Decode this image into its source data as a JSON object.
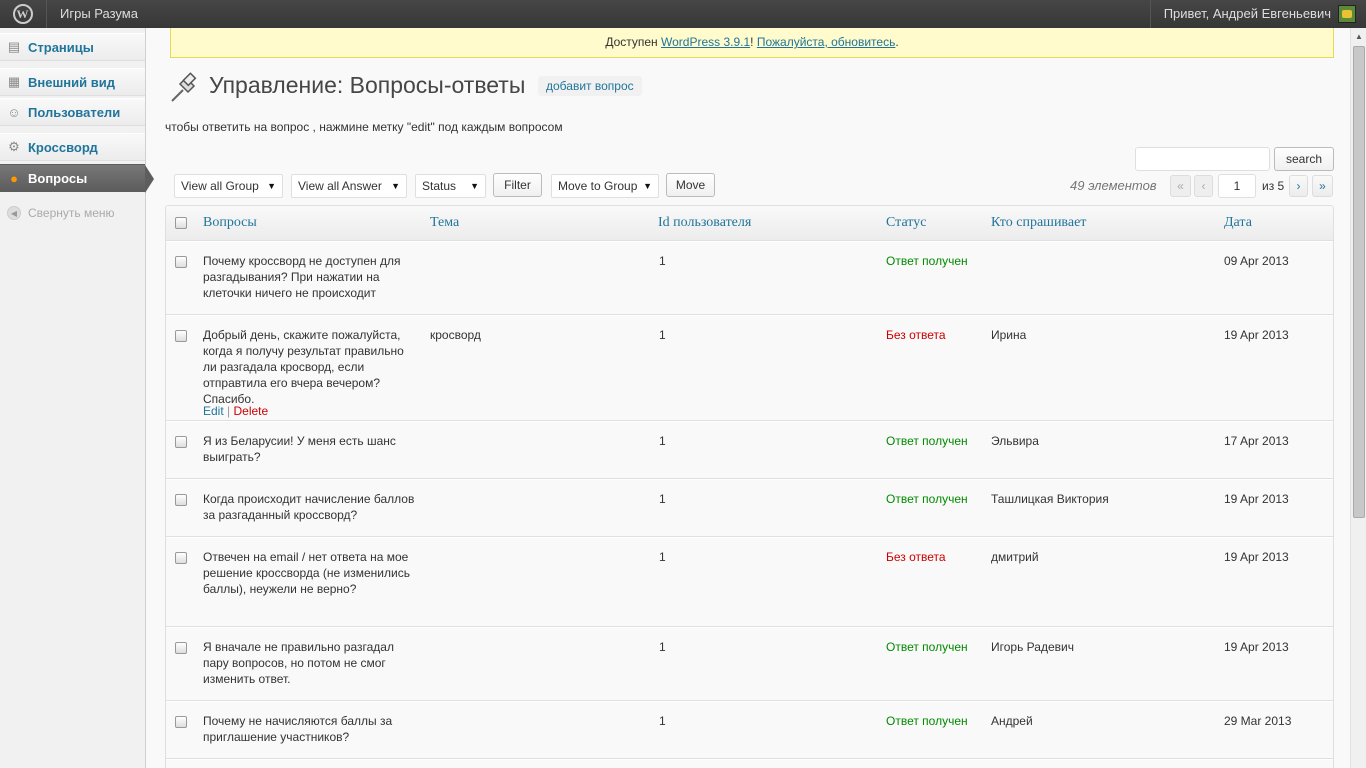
{
  "adminbar": {
    "logo_glyph": "W",
    "site_name": "Игры Разума",
    "howdy": "Привет, Андрей Евгеньевич"
  },
  "sidebar": {
    "items": [
      {
        "label": "Страницы",
        "icon": "pages-icon",
        "glyph": "▤"
      },
      {
        "label": "Внешний вид",
        "icon": "appearance-icon",
        "glyph": "▦"
      },
      {
        "label": "Пользователи",
        "icon": "users-icon",
        "glyph": "☺"
      },
      {
        "label": "Кроссворд",
        "icon": "gear-icon",
        "glyph": "⚙"
      },
      {
        "label": "Вопросы",
        "icon": "questions-icon",
        "glyph": "●"
      }
    ],
    "collapse_label": "Свернуть меню",
    "collapse_glyph": "◀"
  },
  "update_nag": {
    "prefix": "Доступен ",
    "link1": "WordPress 3.9.1",
    "sep": "! ",
    "link2": "Пожалуйста, обновитесь",
    "suffix": "."
  },
  "page": {
    "title": "Управление: Вопросы-ответы",
    "add_button": "добавит вопрос",
    "hint": "чтобы ответить на вопрос , нажмине метку \"edit\" под каждым вопросом"
  },
  "search": {
    "value": "",
    "button": "search"
  },
  "filters": {
    "group": "View all Group",
    "answer": "View all Answer",
    "status": "Status",
    "filter_button": "Filter",
    "move_select": "Move to Group",
    "move_button": "Move"
  },
  "pagination": {
    "items_count": "49 элементов",
    "first": "«",
    "prev": "‹",
    "current": "1",
    "of": "из 5",
    "next": "›",
    "last": "»"
  },
  "table": {
    "columns": [
      "Вопросы",
      "Тема",
      "Id пользователя",
      "Статус",
      "Кто спрашивает",
      "Дата"
    ],
    "rows": [
      {
        "question": "Почему кроссворд не доступен для разгадывания? При нажатии на клеточки ничего не происходит",
        "topic": "",
        "user_id": "1",
        "status": "Ответ получен",
        "asker": "",
        "date": "09 Apr 2013"
      },
      {
        "question": "Добрый день, скажите пожалуйста, когда я получу результат правильно ли разгадала кросворд, если отправтила его вчера вечером? Спасибо.",
        "topic": "кросворд",
        "user_id": "1",
        "status": "Без ответа",
        "asker": "Ирина",
        "date": "19 Apr 2013"
      },
      {
        "question": "Я из Беларусии! У меня есть шанс выиграть?",
        "topic": "",
        "user_id": "1",
        "status": "Ответ получен",
        "asker": "Эльвира",
        "date": "17 Apr 2013"
      },
      {
        "question": "Когда происходит начисление баллов за разгаданный кроссворд?",
        "topic": "",
        "user_id": "1",
        "status": "Ответ получен",
        "asker": "Ташлицкая Виктория",
        "date": "19 Apr 2013"
      },
      {
        "question": "Отвечен на email / нет ответа на мое решение кроссворда (не изменились баллы), неужели не верно?",
        "topic": "",
        "user_id": "1",
        "status": "Без ответа",
        "asker": "дмитрий",
        "date": "19 Apr 2013"
      },
      {
        "question": "Я вначале не правильно разгадал пару вопросов, но потом не смог изменить ответ.",
        "topic": "",
        "user_id": "1",
        "status": "Ответ получен",
        "asker": "Игорь Радевич",
        "date": "19 Apr 2013"
      },
      {
        "question": "Почему не начисляются баллы за приглашение участников?",
        "topic": "",
        "user_id": "1",
        "status": "Ответ получен",
        "asker": "Андрей",
        "date": "29 Mar 2013"
      }
    ],
    "row_actions": {
      "edit": "Edit",
      "sep": " | ",
      "delete": "Delete"
    }
  },
  "colors": {
    "link": "#21759b",
    "answered": "#008a00",
    "unanswered": "#c00000",
    "adminbar": "#464646",
    "nag_bg": "#fffbcc"
  }
}
